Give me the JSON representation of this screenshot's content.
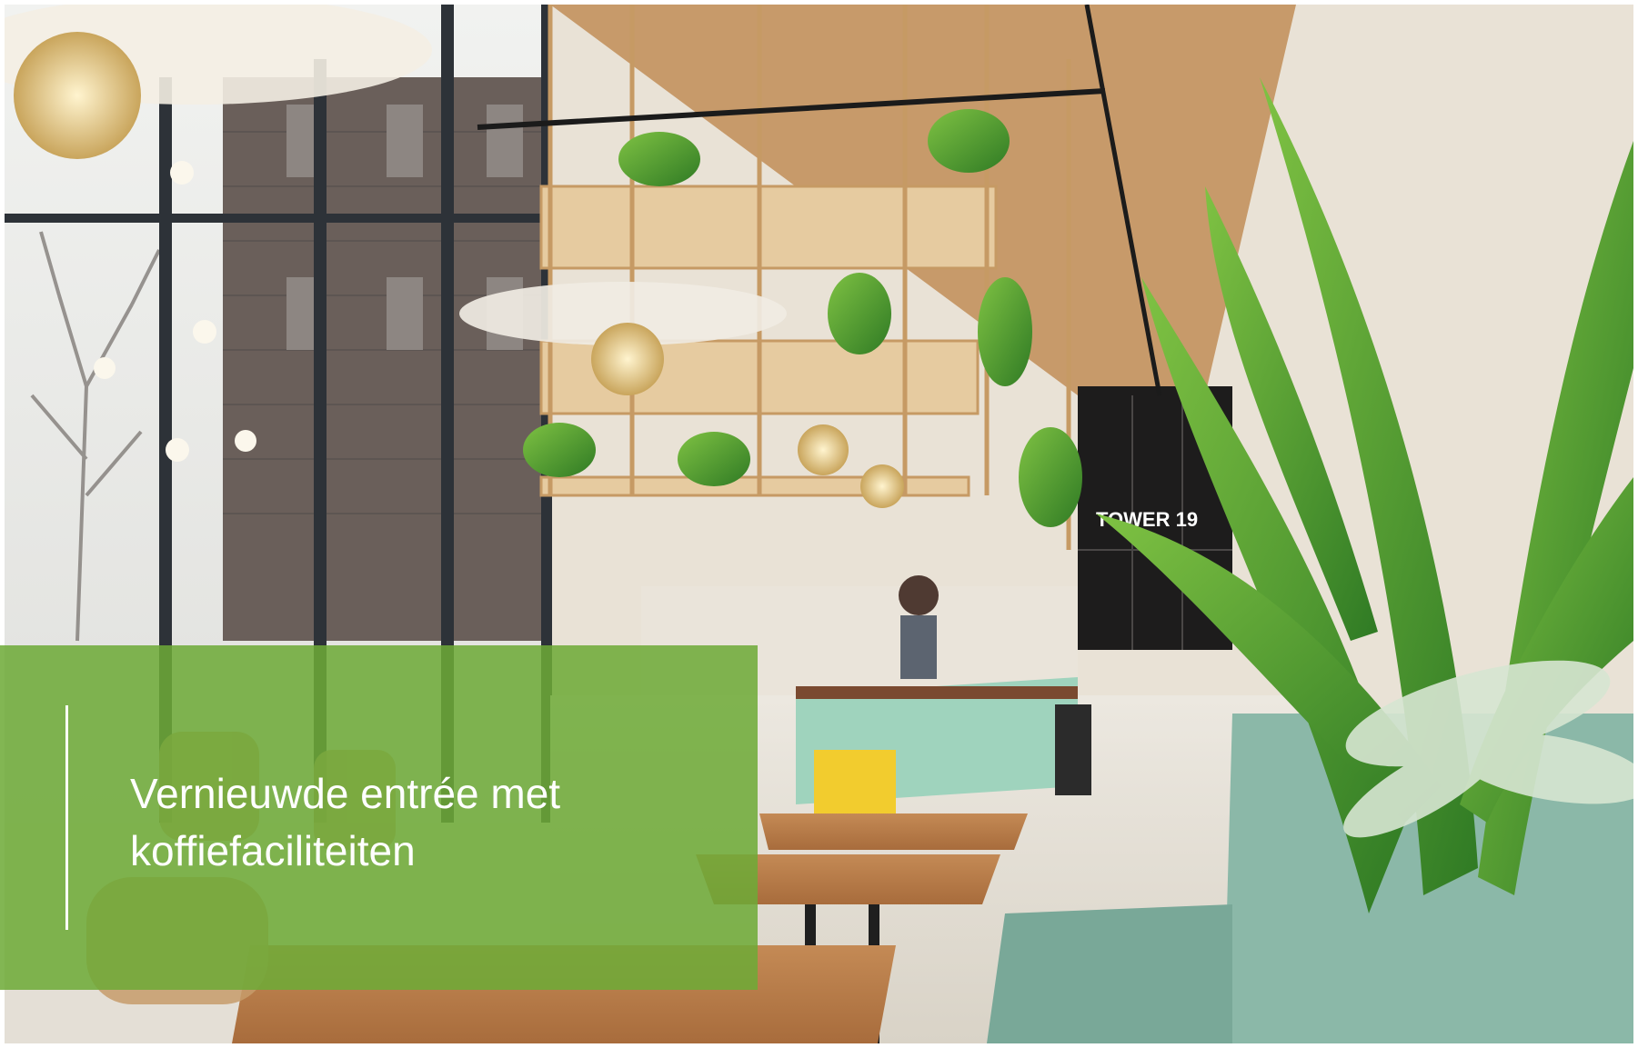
{
  "caption": {
    "line1": "Vernieuwde entrée met",
    "line2": "koffiefaciliteiten"
  },
  "sign_text": "TOWER 19",
  "colors": {
    "overlay_green": "#6eaa37",
    "caption_text": "#ffffff",
    "accent_line": "#ffffff"
  }
}
